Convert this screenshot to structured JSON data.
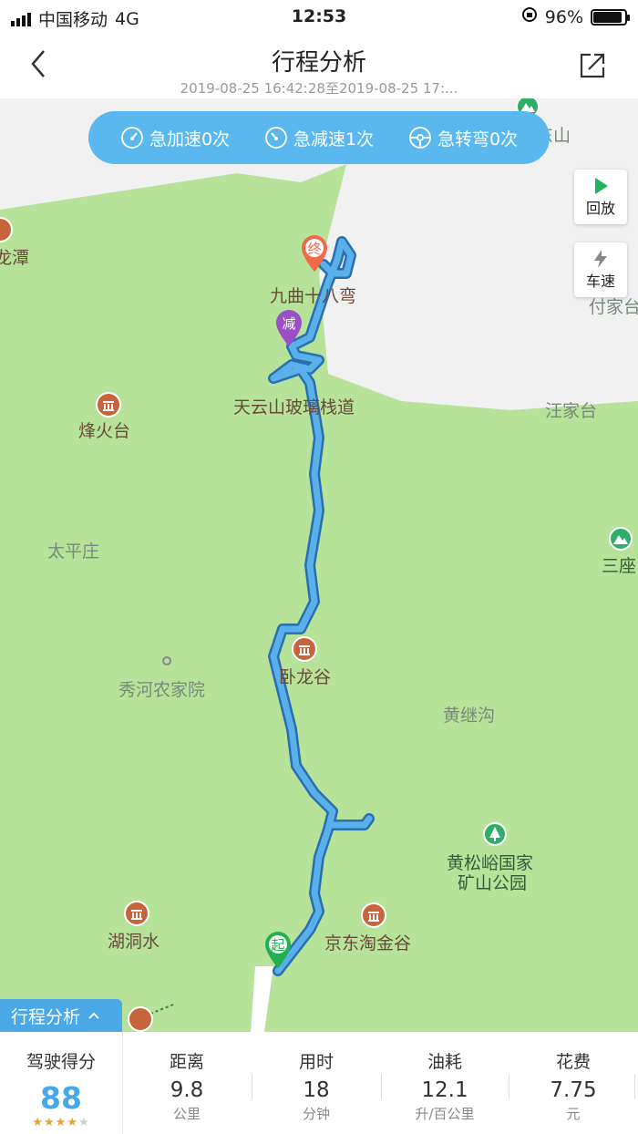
{
  "status_bar": {
    "carrier": "中国移动",
    "network": "4G",
    "time": "12:53",
    "battery": "96%"
  },
  "header": {
    "title": "行程分析",
    "subtitle": "2019-08-25 16:42:28至2019-08-25 17:..."
  },
  "events": [
    {
      "icon": "speedometer-icon",
      "label": "急加速0次"
    },
    {
      "icon": "speedometer-icon",
      "label": "急减速1次"
    },
    {
      "icon": "steering-wheel-icon",
      "label": "急转弯0次"
    }
  ],
  "side_buttons": {
    "replay": "回放",
    "speed": "车速"
  },
  "markers": {
    "end": "终",
    "decel": "减",
    "start": "起"
  },
  "map_labels": {
    "dong_shan": "东山",
    "long_tan": "龙潭",
    "jiuqu": "九曲十八弯",
    "fu_jia_tai": "付家台",
    "tianyun": "天云山玻璃栈道",
    "wang_jia_tai": "汪家台",
    "feng_huo_tai": "烽火台",
    "tai_ping_zhuang": "太平庄",
    "san_zuo": "三座",
    "wo_long_gu": "卧龙谷",
    "xiu_he": "秀河农家院",
    "huang_ji_gou": "黄继沟",
    "huang_song_yu": "黄松峪国家",
    "huang_song_yu_2": "矿山公园",
    "hu_dong_shui": "湖洞水",
    "jingdong": "京东淘金谷"
  },
  "bottom_tag": "行程分析",
  "stats": {
    "score_label": "驾驶得分",
    "score": "88",
    "score_stars": 4,
    "items": [
      {
        "label": "距离",
        "value": "9.8",
        "unit": "公里"
      },
      {
        "label": "用时",
        "value": "18",
        "unit": "分钟"
      },
      {
        "label": "油耗",
        "value": "12.1",
        "unit": "升/百公里"
      },
      {
        "label": "花费",
        "value": "7.75",
        "unit": "元"
      }
    ]
  },
  "colors": {
    "accent": "#4aa8e6",
    "route": "#3a8fd0",
    "map_green": "#b6e29a",
    "end_marker": "#f06a4a",
    "decel_marker": "#9a4fc8",
    "start_marker": "#22b050"
  }
}
